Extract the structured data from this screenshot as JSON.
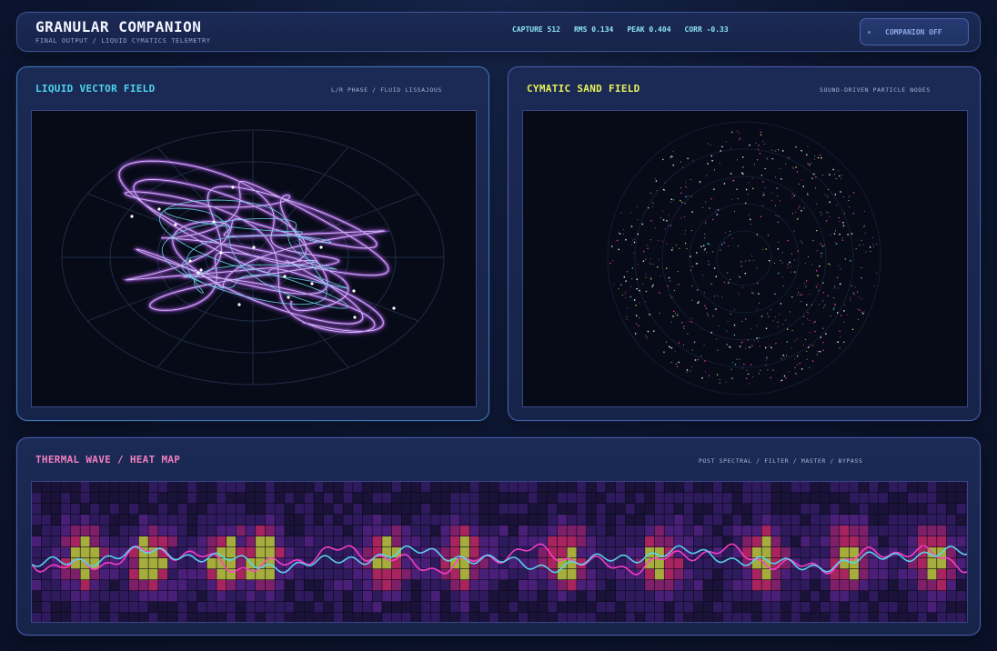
{
  "header": {
    "title": "GRANULAR COMPANION",
    "subtitle": "FINAL OUTPUT / LIQUID CYMATICS TELEMETRY",
    "stats": {
      "capture": "CAPTURE 512",
      "rms": "RMS 0.134",
      "peak": "PEAK 0.404",
      "corr": "CORR -0.33"
    },
    "companion_button": "COMPANION OFF"
  },
  "vector_panel": {
    "title": "LIQUID VECTOR FIELD",
    "tag": "L/R PHASE / FLUID LISSAJOUS"
  },
  "sand_panel": {
    "title": "CYMATIC SAND FIELD",
    "tag": "SOUND-DRIVEN PARTICLE NODES"
  },
  "thermal_panel": {
    "title": "THERMAL WAVE / HEAT MAP",
    "tag": "POST SPECTRAL / FILTER / MASTER / BYPASS"
  },
  "colors": {
    "cyan_title": "#4fd3ee",
    "yellow_title": "#e8f05a",
    "pink_title": "#f27fc0",
    "magenta_wave": "#ff3fc8",
    "cyan_wave": "#58d8f2",
    "lissajous_glow": "#b45cf0"
  }
}
